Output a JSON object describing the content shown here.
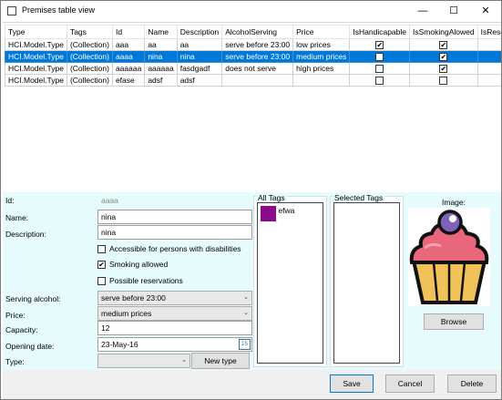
{
  "window": {
    "title": "Premises table view",
    "minimize": "—",
    "maximize": "☐",
    "close": "✕"
  },
  "grid": {
    "columns": [
      "Type",
      "Tags",
      "Id",
      "Name",
      "Description",
      "AlcoholServing",
      "Price",
      "IsHandicapable",
      "IsSmokingAlowed",
      "IsReservingAv"
    ],
    "rows": [
      {
        "type": "HCI.Model.Type",
        "tags": "(Collection)",
        "id": "aaa",
        "name": "aa",
        "description": "aa",
        "alcohol": "serve before 23:00",
        "price": "low prices",
        "handicap": true,
        "smoking": true,
        "reserving": false,
        "selected": false
      },
      {
        "type": "HCI.Model.Type",
        "tags": "(Collection)",
        "id": "aaaa",
        "name": "nina",
        "description": "nina",
        "alcohol": "serve before 23:00",
        "price": "medium prices",
        "handicap": false,
        "smoking": true,
        "reserving": false,
        "selected": true
      },
      {
        "type": "HCI.Model.Type",
        "tags": "(Collection)",
        "id": "aaaaaa",
        "name": "aaaaaa",
        "description": "fasdgadf",
        "alcohol": "does not serve",
        "price": "high prices",
        "handicap": false,
        "smoking": true,
        "reserving": true,
        "selected": false
      },
      {
        "type": "HCI.Model.Type",
        "tags": "(Collection)",
        "id": "efase",
        "name": "adsf",
        "description": "adsf",
        "alcohol": "",
        "price": "",
        "handicap": false,
        "smoking": false,
        "reserving": false,
        "selected": false
      }
    ]
  },
  "form": {
    "id_label": "Id:",
    "id_value": "aaaa",
    "name_label": "Name:",
    "name_value": "nina",
    "description_label": "Description:",
    "description_value": "nina",
    "accessible_label": "Accessible for persons with disabilities",
    "accessible_checked": false,
    "smoking_label": "Smoking allowed",
    "smoking_checked": true,
    "reservations_label": "Possible reservations",
    "reservations_checked": false,
    "alcohol_label": "Serving alcohol:",
    "alcohol_value": "serve before 23:00",
    "price_label": "Price:",
    "price_value": "medium prices",
    "capacity_label": "Capacity:",
    "capacity_value": "12",
    "opening_label": "Opening date:",
    "opening_value": "23-May-16",
    "calendar_glyph": "15",
    "type_label": "Type:",
    "type_value": "",
    "new_type_button": "New type"
  },
  "tags": {
    "all_title": "All Tags",
    "selected_title": "Selected Tags",
    "all": [
      {
        "name": "efwa",
        "color": "#8b0a8b"
      }
    ],
    "selected": []
  },
  "image": {
    "label": "Image:",
    "browse_button": "Browse"
  },
  "actions": {
    "save": "Save",
    "cancel": "Cancel",
    "delete": "Delete"
  },
  "colors": {
    "selection": "#0078d7",
    "form_bg": "#e6fbfb",
    "tag_color": "#8b0a8b"
  }
}
